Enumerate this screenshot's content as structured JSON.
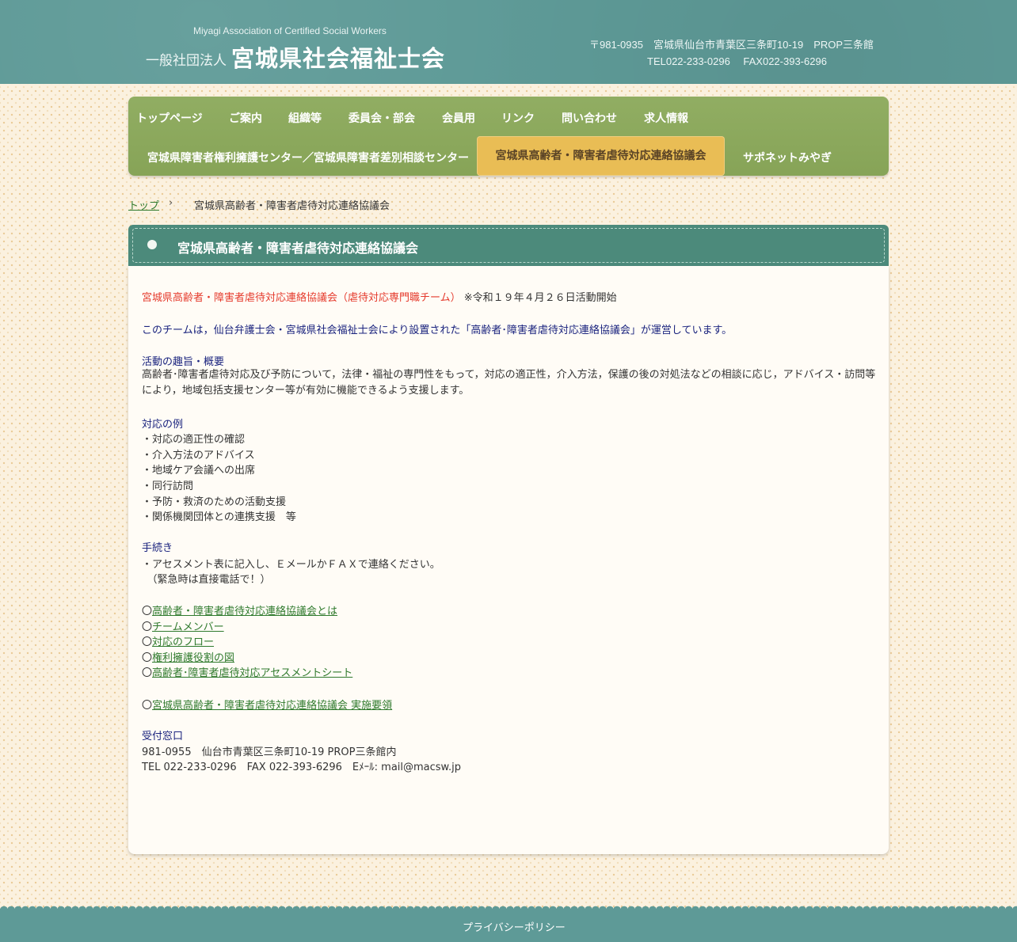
{
  "header": {
    "org_en": "Miyagi Association of Certified Social Workers",
    "org_prefix": "一般社団法人",
    "org_name": "宮城県社会福祉士会",
    "address_line": "〒981-0935　宮城県仙台市青葉区三条町10-19　PROP三条館",
    "phone_line": "TEL022-233-0296　 FAX022-393-6296"
  },
  "nav": {
    "row1": [
      "トップページ",
      "ご案内",
      "組織等",
      "委員会・部会",
      "会員用",
      "リンク",
      "問い合わせ",
      "求人情報"
    ],
    "row2": [
      "宮城県障害者権利擁護センター／宮城県障害者差別相談センター",
      "宮城県高齢者・障害者虐待対応連絡協議会",
      "サポネットみやぎ"
    ],
    "active": "宮城県高齢者・障害者虐待対応連絡協議会"
  },
  "breadcrumb": {
    "home": "トップ",
    "separator": "›",
    "current": "宮城県高齢者・障害者虐待対応連絡協議会"
  },
  "page_title": "宮城県高齢者・障害者虐待対応連絡協議会",
  "content": {
    "intro_red": "宮城県高齢者・障害者虐待対応連絡協議会（虐待対応専門職チーム）",
    "intro_note": "※令和１９年４月２６日活動開始",
    "team_desc": "このチームは，仙台弁護士会・宮城県社会福祉士会により設置された「高齢者･障害者虐待対応連絡協議会」が運営しています。",
    "purpose_heading": "活動の趣旨・概要",
    "purpose_text": "高齢者･障害者虐待対応及び予防について，法律・福祉の専門性をもって，対応の適正性，介入方法，保護の後の対処法などの相談に応じ，アドバイス・訪問等により，地域包括支援センター等が有効に機能できるよう支援します。",
    "examples_heading": "対応の例",
    "examples": [
      "・対応の適正性の確認",
      "・介入方法のアドバイス",
      "・地域ケア会議への出席",
      "・同行訪問",
      "・予防・救済のための活動支援",
      "・関係機関団体との連携支援　等"
    ],
    "procedure_heading": "手続き",
    "procedure_lines": [
      "・アセスメント表に記入し、ＥメールかＦＡＸで連絡ください。",
      "　（緊急時は直接電話で！）"
    ],
    "bullet": "〇",
    "links": [
      "高齢者・障害者虐待対応連絡協議会とは",
      "チームメンバー",
      "対応のフロー",
      "権利擁護役割の図",
      "高齢者･障害者虐待対応アセスメントシート"
    ],
    "extra_link": "宮城県高齢者・障害者虐待対応連絡協議会 実施要領",
    "reception_heading": "受付窓口",
    "reception_address": "981-0955　仙台市青葉区三条町10-19 PROP三条館内",
    "reception_contact": "TEL 022-233-0296　FAX 022-393-6296　Eﾒｰﾙ: mail@macsw.jp"
  },
  "footer": {
    "privacy_link": "プライバシーポリシー"
  },
  "colors": {
    "header_bg": "#5e9a97",
    "nav_bg": "#8ba95a",
    "nav_active_bg": "#e9bd55",
    "title_bar_bg": "#4c8a7b",
    "heading_color": "#1a237e",
    "alert_color": "#e53a2c",
    "link_color": "#2f7a2d"
  }
}
